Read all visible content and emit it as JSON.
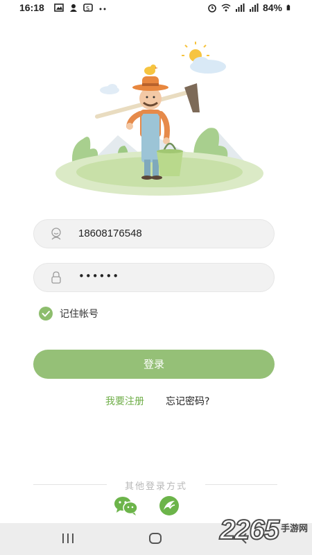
{
  "status_bar": {
    "time": "16:18",
    "battery": "84%"
  },
  "login_form": {
    "phone_value": "18608176548",
    "password_mask": "••••••",
    "remember_label": "记住帐号",
    "remember_checked": true,
    "login_button": "登录"
  },
  "links": {
    "register": "我要注册",
    "forgot": "忘记密码?"
  },
  "other_login": {
    "label": "其他登录方式"
  },
  "watermark": {
    "number": "2265",
    "text": "手游网"
  },
  "colors": {
    "accent": "#95c077",
    "link": "#6fae48",
    "field_bg": "#f2f2f2"
  },
  "icons": {
    "phone_field": "user-icon",
    "password_field": "lock-icon",
    "social_1": "wechat-icon",
    "social_2": "alt-login-icon"
  }
}
